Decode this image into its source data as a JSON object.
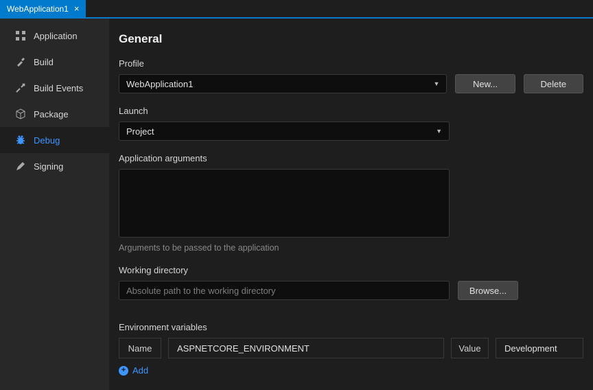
{
  "tab": {
    "title": "WebApplication1"
  },
  "sidebar": {
    "items": [
      {
        "label": "Application"
      },
      {
        "label": "Build"
      },
      {
        "label": "Build Events"
      },
      {
        "label": "Package"
      },
      {
        "label": "Debug"
      },
      {
        "label": "Signing"
      }
    ]
  },
  "section": {
    "title": "General"
  },
  "profile": {
    "label": "Profile",
    "value": "WebApplication1",
    "new_button": "New...",
    "delete_button": "Delete"
  },
  "launch": {
    "label": "Launch",
    "value": "Project"
  },
  "app_args": {
    "label": "Application arguments",
    "help": "Arguments to be passed to the application"
  },
  "workdir": {
    "label": "Working directory",
    "placeholder": "Absolute path to the working directory",
    "browse_button": "Browse..."
  },
  "envvars": {
    "label": "Environment variables",
    "name_header": "Name",
    "value_header": "Value",
    "rows": [
      {
        "name": "ASPNETCORE_ENVIRONMENT",
        "value": "Development"
      }
    ],
    "add_label": "Add"
  }
}
